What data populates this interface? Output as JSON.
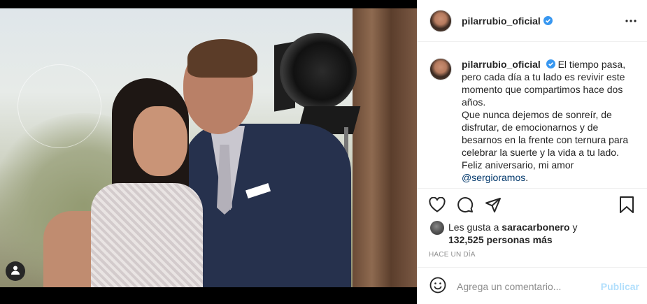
{
  "post": {
    "username": "pilarrubio_oficial",
    "verified": true,
    "more_icon": "more-horizontal-icon"
  },
  "caption": {
    "username": "pilarrubio_oficial",
    "text_1": "El tiempo pasa, pero cada día a tu lado es revivir este momento que compartimos hace dos años.",
    "text_2": "Que nunca dejemos de sonreír, de disfrutar, de emocionarnos y de besarnos en la frente con ternura para celebrar la suerte y la vida a tu lado.",
    "text_3": "Feliz aniversario, mi amor",
    "mention": "@sergioramos",
    "trailing": "."
  },
  "actions": {
    "icons": [
      "heart-icon",
      "comment-icon",
      "share-icon",
      "bookmark-icon"
    ]
  },
  "likes": {
    "prefix": "Les gusta a",
    "user": "saracarbonero",
    "middle": "y",
    "count": "132,525 personas más"
  },
  "timestamp": "HACE UN DÍA",
  "comment": {
    "placeholder": "Agrega un comentario...",
    "post_label": "Publicar"
  },
  "colors": {
    "verified_blue": "#3897f0",
    "post_button_disabled": "#b2dffc",
    "mention": "#00376b",
    "muted": "#8e8e8e"
  }
}
